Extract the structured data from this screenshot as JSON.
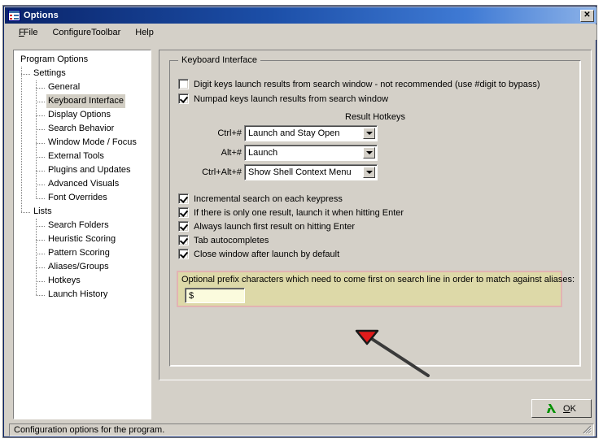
{
  "window": {
    "title": "Options",
    "icon": "options-window-icon",
    "close_label": "✕"
  },
  "menu": {
    "items": [
      {
        "label": "File",
        "mnemonic": "F"
      },
      {
        "label": "ConfigureToolbar",
        "mnemonic": "C"
      },
      {
        "label": "Help",
        "mnemonic": "H"
      }
    ]
  },
  "tree": {
    "nodes": [
      {
        "label": "Program Options",
        "depth": 0,
        "selected": false
      },
      {
        "label": "Settings",
        "depth": 1,
        "selected": false
      },
      {
        "label": "General",
        "depth": 2,
        "selected": false
      },
      {
        "label": "Keyboard Interface",
        "depth": 2,
        "selected": true
      },
      {
        "label": "Display Options",
        "depth": 2,
        "selected": false
      },
      {
        "label": "Search Behavior",
        "depth": 2,
        "selected": false
      },
      {
        "label": "Window Mode / Focus",
        "depth": 2,
        "selected": false
      },
      {
        "label": "External Tools",
        "depth": 2,
        "selected": false
      },
      {
        "label": "Plugins and Updates",
        "depth": 2,
        "selected": false
      },
      {
        "label": "Advanced Visuals",
        "depth": 2,
        "selected": false
      },
      {
        "label": "Font Overrides",
        "depth": 2,
        "selected": false
      },
      {
        "label": "Lists",
        "depth": 1,
        "selected": false
      },
      {
        "label": "Search Folders",
        "depth": 2,
        "selected": false
      },
      {
        "label": "Heuristic Scoring",
        "depth": 2,
        "selected": false
      },
      {
        "label": "Pattern Scoring",
        "depth": 2,
        "selected": false
      },
      {
        "label": "Aliases/Groups",
        "depth": 2,
        "selected": false
      },
      {
        "label": "Hotkeys",
        "depth": 2,
        "selected": false
      },
      {
        "label": "Launch History",
        "depth": 2,
        "selected": false
      }
    ]
  },
  "panel": {
    "group_title": "Keyboard Interface",
    "top_checkboxes": [
      {
        "label": "Digit keys launch results from search window  - not recommended (use #digit to bypass)",
        "checked": false
      },
      {
        "label": "Numpad keys launch results from search window",
        "checked": true
      }
    ],
    "hotkeys": {
      "title": "Result Hotkeys",
      "rows": [
        {
          "label": "Ctrl+#",
          "value": "Launch and Stay Open"
        },
        {
          "label": "Alt+#",
          "value": "Launch"
        },
        {
          "label": "Ctrl+Alt+#",
          "value": "Show Shell Context Menu"
        }
      ]
    },
    "bottom_checkboxes": [
      {
        "label": "Incremental search on each keypress",
        "checked": true
      },
      {
        "label": "If there is only one result, launch it when hitting Enter",
        "checked": true
      },
      {
        "label": "Always launch first result on hitting Enter",
        "checked": true
      },
      {
        "label": "Tab autocompletes",
        "checked": true
      },
      {
        "label": "Close window after launch by default",
        "checked": true
      }
    ],
    "alias": {
      "label": "Optional prefix characters which need to come first on search line in order to match against aliases:",
      "value": "$",
      "placeholder": ""
    }
  },
  "footer": {
    "ok_label": "OK",
    "ok_mnemonic": "O",
    "status_text": "Configuration options for the program."
  },
  "colors": {
    "titlebar_start": "#0a246a",
    "titlebar_end": "#8cb2e8",
    "face": "#d4d0c8",
    "highlight_panel_bg": "#ddd9a8",
    "highlight_panel_border": "#e2b3b3",
    "alias_input_bg": "#fbfbdd",
    "annotation_arrow": "#e01b1b",
    "tree_selection": "#d2cec4"
  }
}
